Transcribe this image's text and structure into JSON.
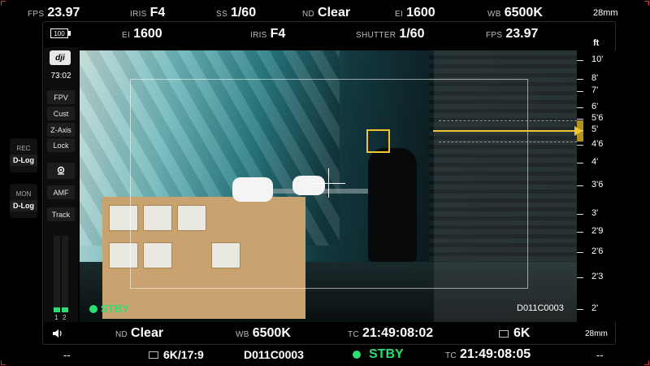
{
  "top_outer": {
    "fps": {
      "label": "FPS",
      "value": "23.97"
    },
    "iris": {
      "label": "IRIS",
      "value": "F4"
    },
    "ss": {
      "label": "SS",
      "value": "1/60"
    },
    "nd": {
      "label": "ND",
      "value": "Clear"
    },
    "ei": {
      "label": "EI",
      "value": "1600"
    },
    "wb": {
      "label": "WB",
      "value": "6500K"
    },
    "focal": "28mm"
  },
  "top_inner": {
    "battery": "100",
    "ei": {
      "label": "EI",
      "value": "1600"
    },
    "iris": {
      "label": "IRIS",
      "value": "F4"
    },
    "shutter": {
      "label": "SHUTTER",
      "value": "1/60"
    },
    "fps": {
      "label": "FPS",
      "value": "23.97"
    }
  },
  "left_panel": {
    "logo": "dji",
    "timer": "73:02",
    "buttons": [
      "FPV",
      "Cust",
      "Z-Axis",
      "Lock"
    ],
    "tool_buttons": [
      "AMF",
      "Track"
    ],
    "meter_labels": [
      "1",
      "2"
    ],
    "meter_levels": [
      0.06,
      0.06
    ],
    "icons": {
      "record_mic": "microphone-icon",
      "speaker": "speaker-icon"
    }
  },
  "outer_left": {
    "rec": {
      "label": "REC",
      "value": "D-Log"
    },
    "mon": {
      "label": "MON",
      "value": "D-Log"
    }
  },
  "video": {
    "status": "STBY",
    "clip": "D011C0003"
  },
  "focus_scale": {
    "unit": "ft",
    "marks": [
      "10'",
      "8'",
      "7'",
      "6'",
      "5'6",
      "5'",
      "4'6",
      "4'",
      "3'6",
      "3'",
      "2'9",
      "2'6",
      "2'3",
      "2'"
    ],
    "current": "5'"
  },
  "bottom_inner": {
    "nd": {
      "label": "ND",
      "value": "Clear"
    },
    "wb": {
      "label": "WB",
      "value": "6500K"
    },
    "tc": {
      "label": "TC",
      "value": "21:49:08:02"
    },
    "resolution": "6K",
    "focal": "28mm"
  },
  "bottom_outer": {
    "left": "--",
    "format": "6K/17:9",
    "clip": "D011C0003",
    "status": "STBY",
    "tc": {
      "label": "TC",
      "value": "21:49:08:05"
    },
    "right": "--"
  },
  "colors": {
    "accent_green": "#2ddc73",
    "focus_yellow": "#f2c530"
  }
}
